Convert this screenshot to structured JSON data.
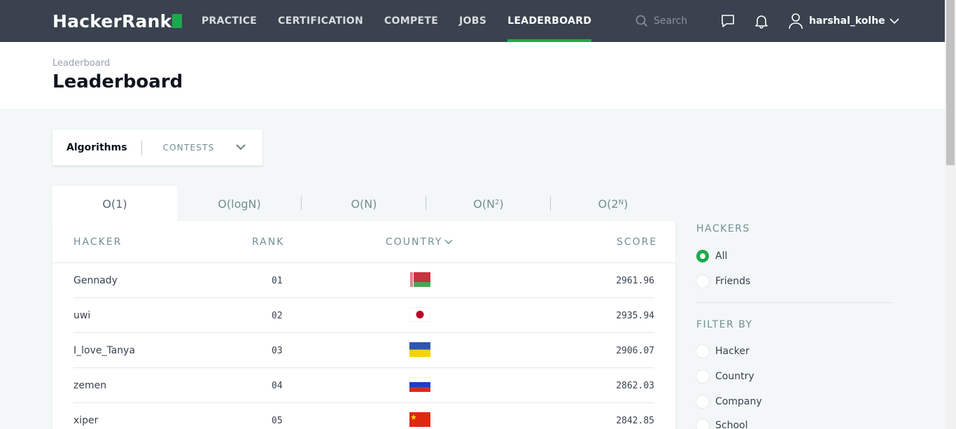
{
  "brand": {
    "name": "HackerRank",
    "accent": "#1ba94c",
    "nav_bg": "#39424e"
  },
  "nav": {
    "links": [
      "PRACTICE",
      "CERTIFICATION",
      "COMPETE",
      "JOBS",
      "LEADERBOARD"
    ],
    "active": "LEADERBOARD",
    "search_placeholder": "Search",
    "icons": [
      "search-icon",
      "messages-icon",
      "notifications-icon",
      "user-icon",
      "chevron-down-icon"
    ],
    "username": "harshal_kolhe"
  },
  "breadcrumb": "Leaderboard",
  "page_title": "Leaderboard",
  "track_selector": {
    "track": "Algorithms",
    "contests_label": "CONTESTS"
  },
  "tabs": [
    {
      "base": "O(1)",
      "sup": ""
    },
    {
      "base": "O(logN)",
      "sup": ""
    },
    {
      "base": "O(N)",
      "sup": ""
    },
    {
      "base": "O(N",
      "sup": "2",
      "tail": ")"
    },
    {
      "base": "O(2",
      "sup": "N",
      "tail": ")"
    }
  ],
  "active_tab": 0,
  "table": {
    "headers": {
      "hacker": "HACKER",
      "rank": "RANK",
      "country": "COUNTRY",
      "score": "SCORE"
    },
    "rows": [
      {
        "hacker": "Gennady",
        "rank": "01",
        "country": "Belarus",
        "score": "2961.96"
      },
      {
        "hacker": "uwi",
        "rank": "02",
        "country": "Japan",
        "score": "2935.94"
      },
      {
        "hacker": "I_love_Tanya",
        "rank": "03",
        "country": "Ukraine",
        "score": "2906.07"
      },
      {
        "hacker": "zemen",
        "rank": "04",
        "country": "Russia",
        "score": "2862.03"
      },
      {
        "hacker": "xiper",
        "rank": "05",
        "country": "China",
        "score": "2842.85"
      }
    ]
  },
  "hackers_filter": {
    "title": "HACKERS",
    "options": [
      "All",
      "Friends"
    ],
    "selected": "All"
  },
  "filter_by": {
    "title": "FILTER BY",
    "options": [
      "Hacker",
      "Country",
      "Company",
      "School"
    ]
  }
}
